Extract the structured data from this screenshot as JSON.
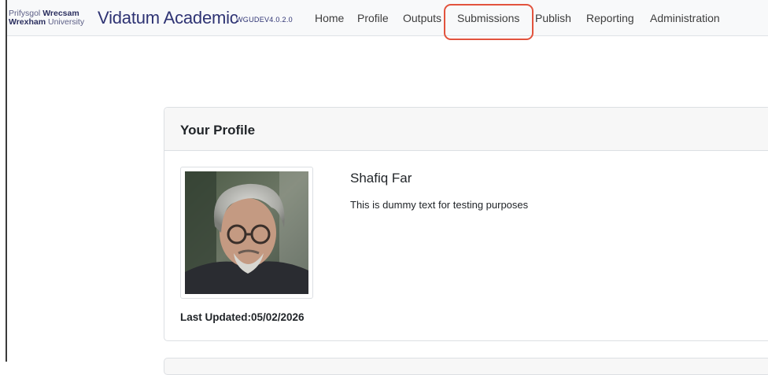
{
  "brand": {
    "logo_line1_light": "Prifysgol",
    "logo_line1_bold": "Wrecsam",
    "logo_line2_bold": "Wrexham",
    "logo_line2_light": "University",
    "title": "Vidatum Academic",
    "version": "WGUDEV4.0.2.0"
  },
  "nav": {
    "items": [
      {
        "label": "Home"
      },
      {
        "label": "Profile"
      },
      {
        "label": "Outputs"
      },
      {
        "label": "Submissions"
      },
      {
        "label": "Publish"
      },
      {
        "label": "Reporting"
      },
      {
        "label": "Administration"
      }
    ],
    "highlighted": "Submissions"
  },
  "profile_card": {
    "title": "Your Profile",
    "name": "Shafiq Far",
    "description": "This is dummy text for testing purposes",
    "last_updated": "Last Updated:05/02/2026"
  },
  "colors": {
    "brand": "#2e3373",
    "navbar_bg": "#f8f9fa",
    "highlight": "#e2533d",
    "card_header_bg": "#f7f7f7"
  }
}
